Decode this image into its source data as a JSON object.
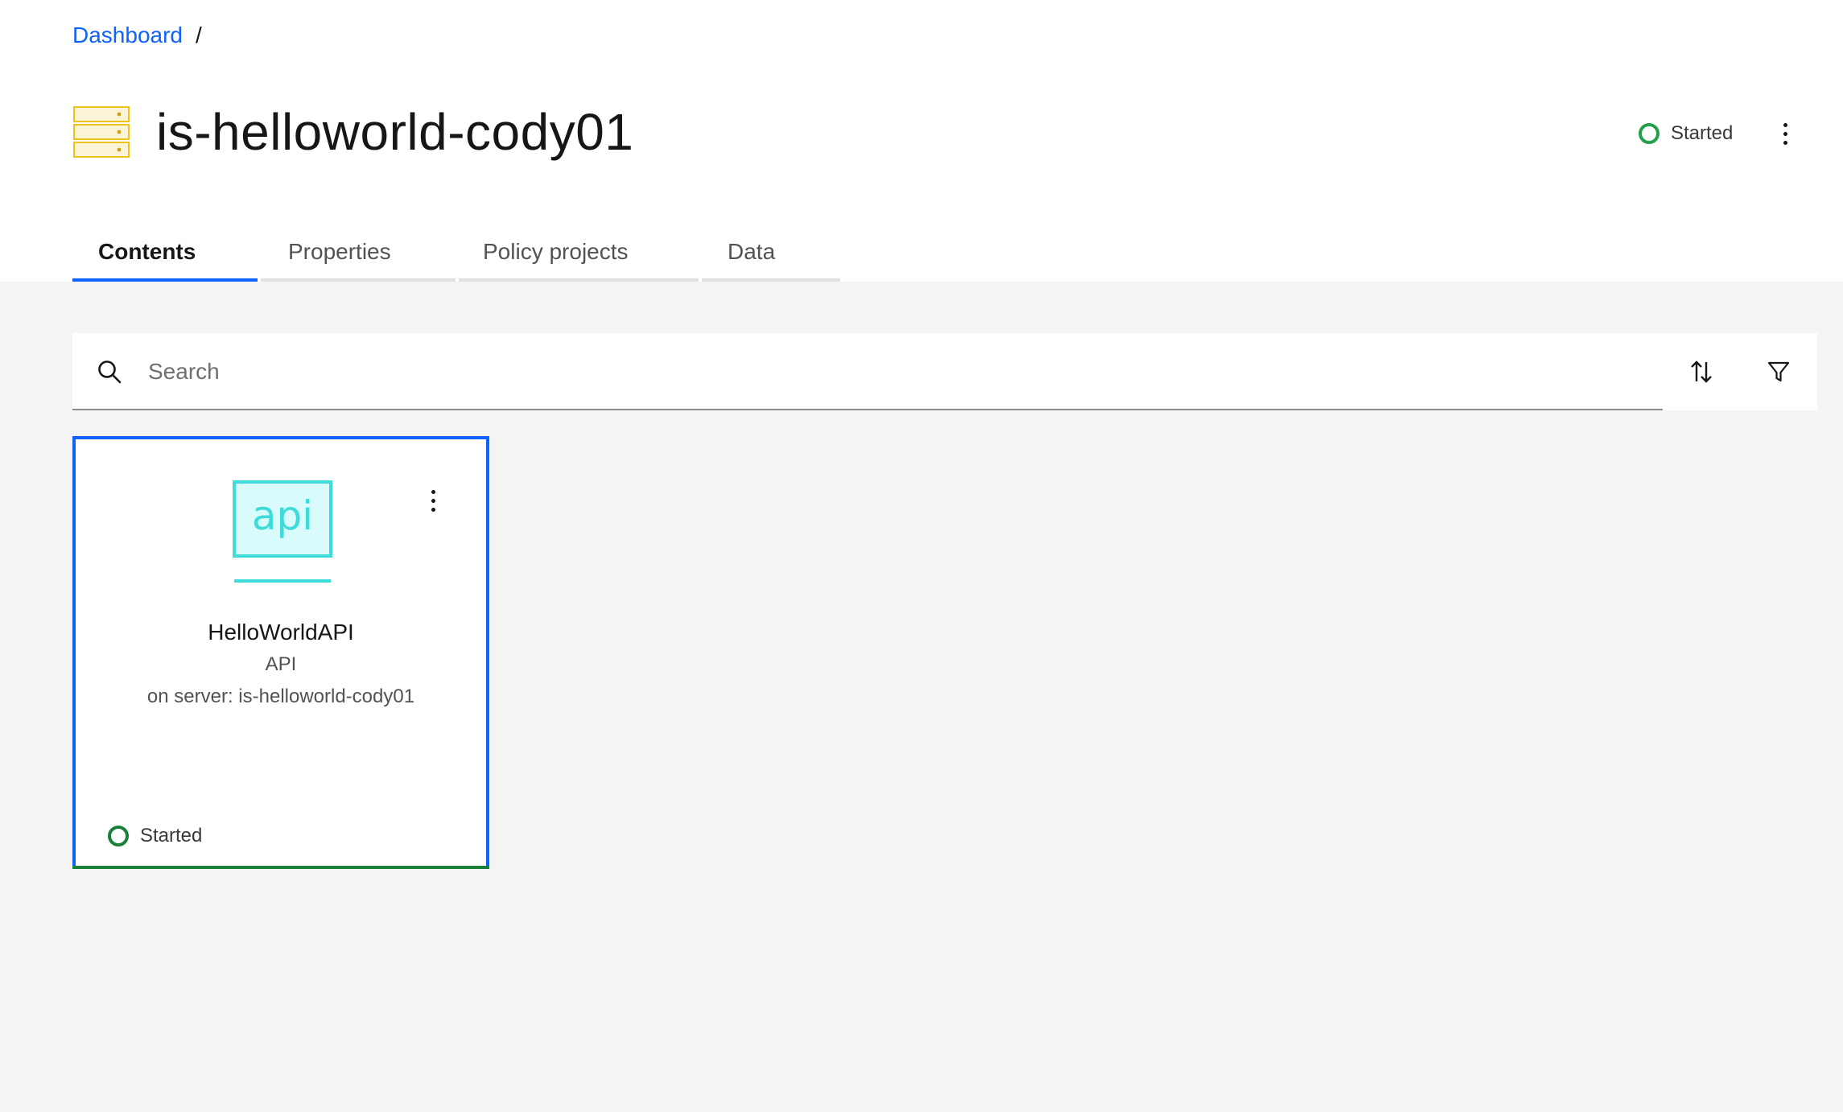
{
  "breadcrumb": {
    "root_label": "Dashboard",
    "separator": "/"
  },
  "header": {
    "title": "is-helloworld-cody01",
    "icon": "server-stack-icon",
    "status_label": "Started",
    "status_color": "#24a148"
  },
  "tabs": [
    {
      "label": "Contents",
      "active": true
    },
    {
      "label": "Properties",
      "active": false
    },
    {
      "label": "Policy projects",
      "active": false
    },
    {
      "label": "Data",
      "active": false
    }
  ],
  "search": {
    "placeholder": "Search",
    "value": ""
  },
  "toolbar": {
    "sort_icon": "sort-icon",
    "filter_icon": "filter-icon"
  },
  "cards": [
    {
      "icon": "api-icon",
      "icon_text": "api",
      "name": "HelloWorldAPI",
      "type": "API",
      "server": "on server: is-helloworld-cody01",
      "status_label": "Started",
      "status_color": "#198038"
    }
  ],
  "colors": {
    "accent": "#0f62fe",
    "success": "#24a148",
    "server_icon": "#f1c21b",
    "api_icon": "#3ddbd9"
  }
}
